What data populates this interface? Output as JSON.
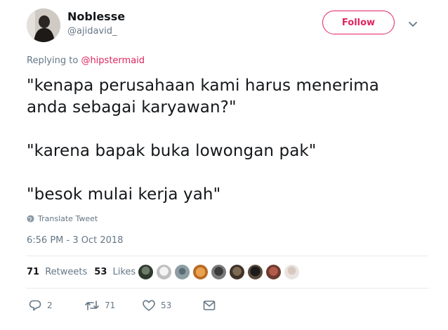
{
  "author": {
    "display_name": "Noblesse",
    "handle": "@ajidavid_"
  },
  "follow_label": "Follow",
  "reply_context": {
    "prefix": "Replying to",
    "mention": "@hipstermaid"
  },
  "tweet": {
    "lines": [
      "\"kenapa perusahaan kami harus menerima",
      "anda sebagai karyawan?\"",
      "\"karena bapak buka lowongan pak\"",
      "\"besok mulai kerja yah\""
    ]
  },
  "translate_label": "Translate Tweet",
  "timestamp": "6:56 PM - 3 Oct 2018",
  "stats": {
    "retweets_count": "71",
    "retweets_label": "Retweets",
    "likes_count": "53",
    "likes_label": "Likes"
  },
  "actions": {
    "replies": "2",
    "retweets": "71",
    "likes": "53"
  },
  "colors": {
    "accent": "#e0245e",
    "muted": "#657786",
    "text": "#14171a"
  },
  "icons": [
    "translate-globe-icon",
    "caret-down-icon",
    "reply-icon",
    "retweet-icon",
    "like-icon",
    "direct-message-icon"
  ]
}
